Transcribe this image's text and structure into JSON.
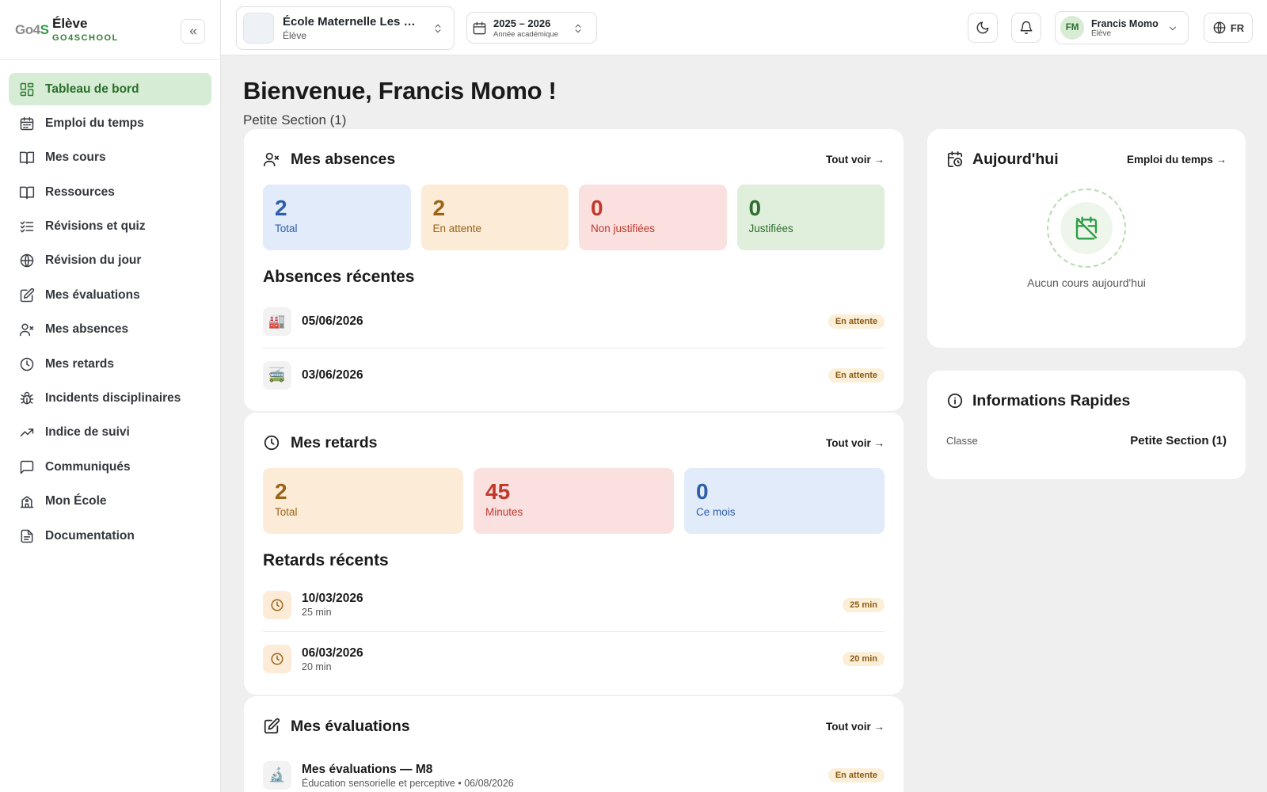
{
  "brand": {
    "logo": "Go4S",
    "role": "Élève",
    "name": "GO4SCHOOL"
  },
  "sidebar": {
    "items": [
      {
        "label": "Tableau de bord",
        "icon": "dashboard-icon",
        "active": true
      },
      {
        "label": "Emploi du temps",
        "icon": "calendar-icon"
      },
      {
        "label": "Mes cours",
        "icon": "book-icon"
      },
      {
        "label": "Ressources",
        "icon": "book-open-icon"
      },
      {
        "label": "Révisions et quiz",
        "icon": "list-check-icon"
      },
      {
        "label": "Révision du jour",
        "icon": "globe-icon"
      },
      {
        "label": "Mes évaluations",
        "icon": "edit-icon"
      },
      {
        "label": "Mes absences",
        "icon": "user-x-icon"
      },
      {
        "label": "Mes retards",
        "icon": "clock-icon"
      },
      {
        "label": "Incidents disciplinaires",
        "icon": "bug-icon"
      },
      {
        "label": "Indice de suivi",
        "icon": "trend-icon"
      },
      {
        "label": "Communiqués",
        "icon": "message-icon"
      },
      {
        "label": "Mon École",
        "icon": "school-icon"
      },
      {
        "label": "Documentation",
        "icon": "document-icon"
      }
    ]
  },
  "topbar": {
    "school": {
      "name": "École Maternelle Les M...",
      "role": "Élève"
    },
    "year": {
      "value": "2025 – 2026",
      "label": "Année académique"
    },
    "user": {
      "initials": "FM",
      "name": "Francis Momo",
      "role": "Élève"
    },
    "lang": "FR"
  },
  "main": {
    "welcome": "Bienvenue, Francis Momo !",
    "subtitle": "Petite Section (1)",
    "absences": {
      "title": "Mes absences",
      "see_all": "Tout voir →",
      "stats": [
        {
          "value": "2",
          "label": "Total",
          "color": "blue"
        },
        {
          "value": "2",
          "label": "En attente",
          "color": "orange"
        },
        {
          "value": "0",
          "label": "Non justifiées",
          "color": "red"
        },
        {
          "value": "0",
          "label": "Justifiées",
          "color": "green"
        }
      ],
      "recent_title": "Absences récentes",
      "recent": [
        {
          "emoji": "🏭",
          "date": "05/06/2026",
          "badge": "En attente"
        },
        {
          "emoji": "🚎",
          "date": "03/06/2026",
          "badge": "En attente"
        }
      ]
    },
    "retards": {
      "title": "Mes retards",
      "see_all": "Tout voir →",
      "stats": [
        {
          "value": "2",
          "label": "Total",
          "color": "orange"
        },
        {
          "value": "45",
          "label": "Minutes",
          "color": "red"
        },
        {
          "value": "0",
          "label": "Ce mois",
          "color": "blue"
        }
      ],
      "recent_title": "Retards récents",
      "recent": [
        {
          "date": "10/03/2026",
          "sub": "25 min",
          "badge": "25 min"
        },
        {
          "date": "06/03/2026",
          "sub": "20 min",
          "badge": "20 min"
        }
      ]
    },
    "evaluations": {
      "title": "Mes évaluations",
      "see_all": "Tout voir →",
      "items": [
        {
          "emoji": "🔬",
          "title": "Mes évaluations — M8",
          "sub": "Éducation sensorielle et perceptive • 06/08/2026",
          "badge": "En attente"
        }
      ]
    }
  },
  "today": {
    "title": "Aujourd'hui",
    "link": "Emploi du temps →",
    "empty": "Aucun cours aujourd'hui"
  },
  "quick_info": {
    "title": "Informations Rapides",
    "label": "Classe",
    "value": "Petite Section (1)"
  }
}
